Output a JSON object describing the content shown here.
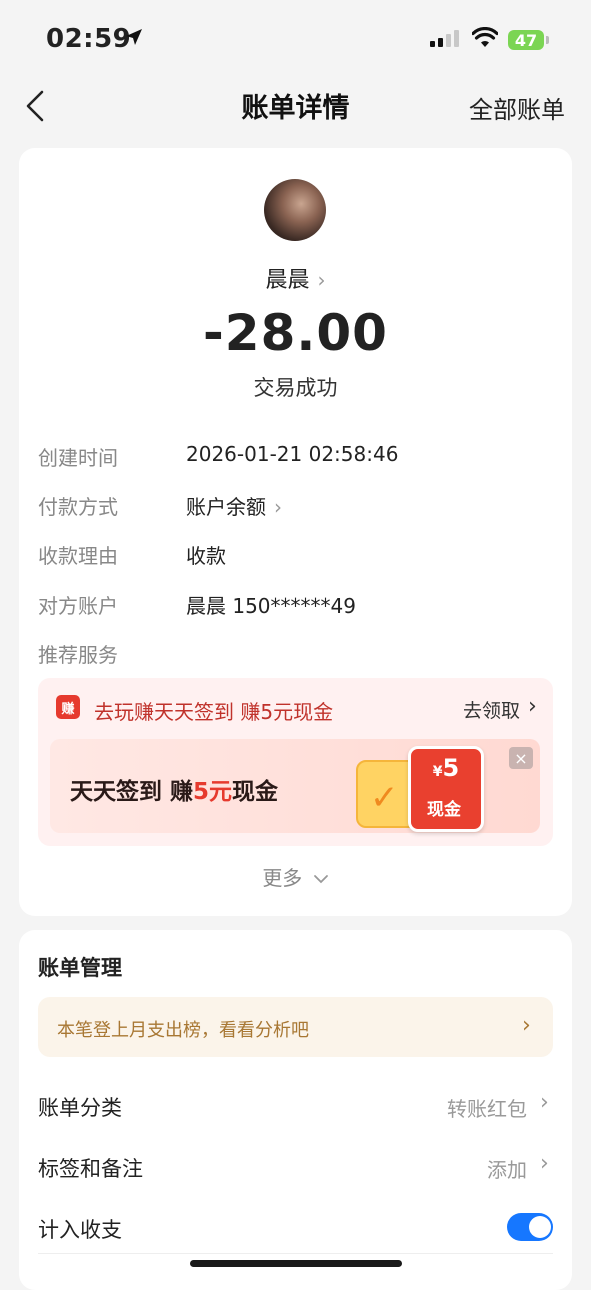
{
  "status_bar": {
    "time": "02:59",
    "battery": "47"
  },
  "header": {
    "title": "账单详情",
    "right_link": "全部账单"
  },
  "transaction": {
    "name": "晨晨",
    "amount": "-28.00",
    "status": "交易成功"
  },
  "details": [
    {
      "label": "创建时间",
      "value": "2026-01-21 02:58:46"
    },
    {
      "label": "付款方式",
      "value": "账户余额"
    },
    {
      "label": "收款理由",
      "value": "收款"
    },
    {
      "label": "对方账户",
      "value": "晨晨 150******49"
    },
    {
      "label": "推荐服务",
      "value": ""
    }
  ],
  "promo": {
    "icon_text": "赚",
    "title": "去玩赚天天签到 赚5元现金",
    "claim": "去领取",
    "banner_prefix": "天天签到 赚",
    "banner_highlight": "5元",
    "banner_suffix": "现金",
    "cash_currency": "¥",
    "cash_amount": "5",
    "cash_label": "现金",
    "close": "×"
  },
  "more": "更多",
  "management": {
    "title": "账单管理",
    "tip": "本笔登上月支出榜，看看分析吧",
    "rows": [
      {
        "label": "账单分类",
        "value": "转账红包"
      },
      {
        "label": "标签和备注",
        "value": "添加"
      },
      {
        "label": "计入收支",
        "value": ""
      }
    ],
    "count_toggle_on": true
  },
  "colors": {
    "accent_blue": "#1677ff",
    "promo_red": "#e63a2e",
    "tip_gold": "#a87733"
  }
}
